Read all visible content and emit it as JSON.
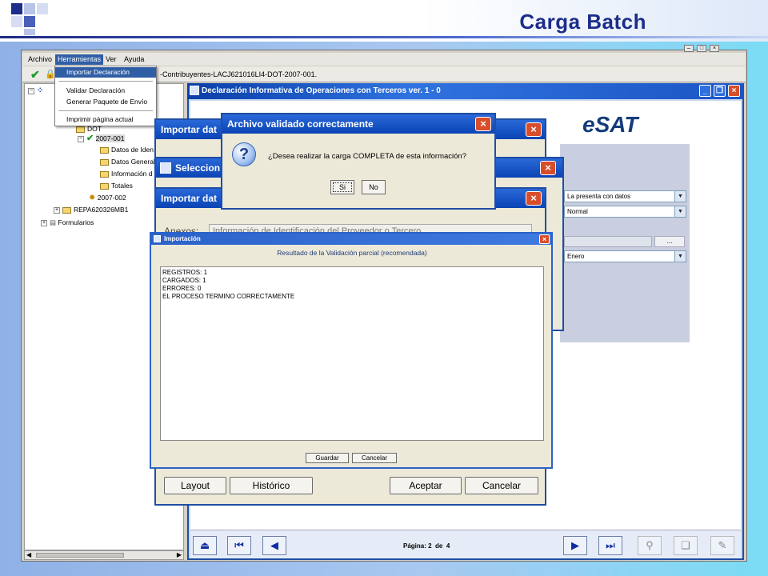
{
  "slide": {
    "title": "Carga Batch",
    "accent_color": "#1c2d8a"
  },
  "app": {
    "menu": [
      "Archivo",
      "Herramientas",
      "Ver",
      "Ayuda"
    ],
    "path_text": "-Contribuyentes-LACJ621016LI4-DOT-2007-001.",
    "dropdown": {
      "items": [
        "Importar Declaración",
        "Validar Declaración",
        "Generar Paquete de Envío",
        "Imprimir página actual"
      ],
      "selected": "Importar Declaración"
    },
    "tree": {
      "nodes": [
        "2007-001",
        "Datos de Iden",
        "Datos General",
        "Información d",
        "Totales",
        "2007-002",
        "REPA620326MB1",
        "Formularios"
      ],
      "dot_label": "DOT"
    }
  },
  "declaracion": {
    "title": "Declaración Informativa de Operaciones con Terceros ver. 1 - 0",
    "logo": "eSAT",
    "combos": [
      "La presenta con datos",
      "Normal",
      "Enero"
    ],
    "ellipsis": "...",
    "pager": {
      "label": "Página:",
      "current": "2",
      "of": "de",
      "total": "4"
    }
  },
  "dialogs": {
    "importar_1": {
      "title": "Importar dat"
    },
    "seleccion": {
      "title": "Seleccion"
    },
    "importar_2": {
      "title": "Importar dat",
      "anexos_label": "Anexos:",
      "anexos_value": "Información de Identificación del Proveedor o Tercero",
      "buttons": [
        "Layout",
        "Histórico",
        "Aceptar",
        "Cancelar"
      ]
    }
  },
  "importacion": {
    "title": "Importación",
    "result_title": "Resultado de la Validación parcial (recomendada)",
    "lines": [
      "REGISTROS: 1",
      "CARGADOS: 1",
      "ERRORES: 0",
      "EL PROCESO TERMINO CORRECTAMENTE"
    ],
    "buttons": [
      "Guardar",
      "Cancelar"
    ]
  },
  "validado": {
    "title": "Archivo validado correctamente",
    "message": "¿Desea realizar la carga COMPLETA de esta información?",
    "buttons": [
      "Si",
      "No"
    ]
  }
}
